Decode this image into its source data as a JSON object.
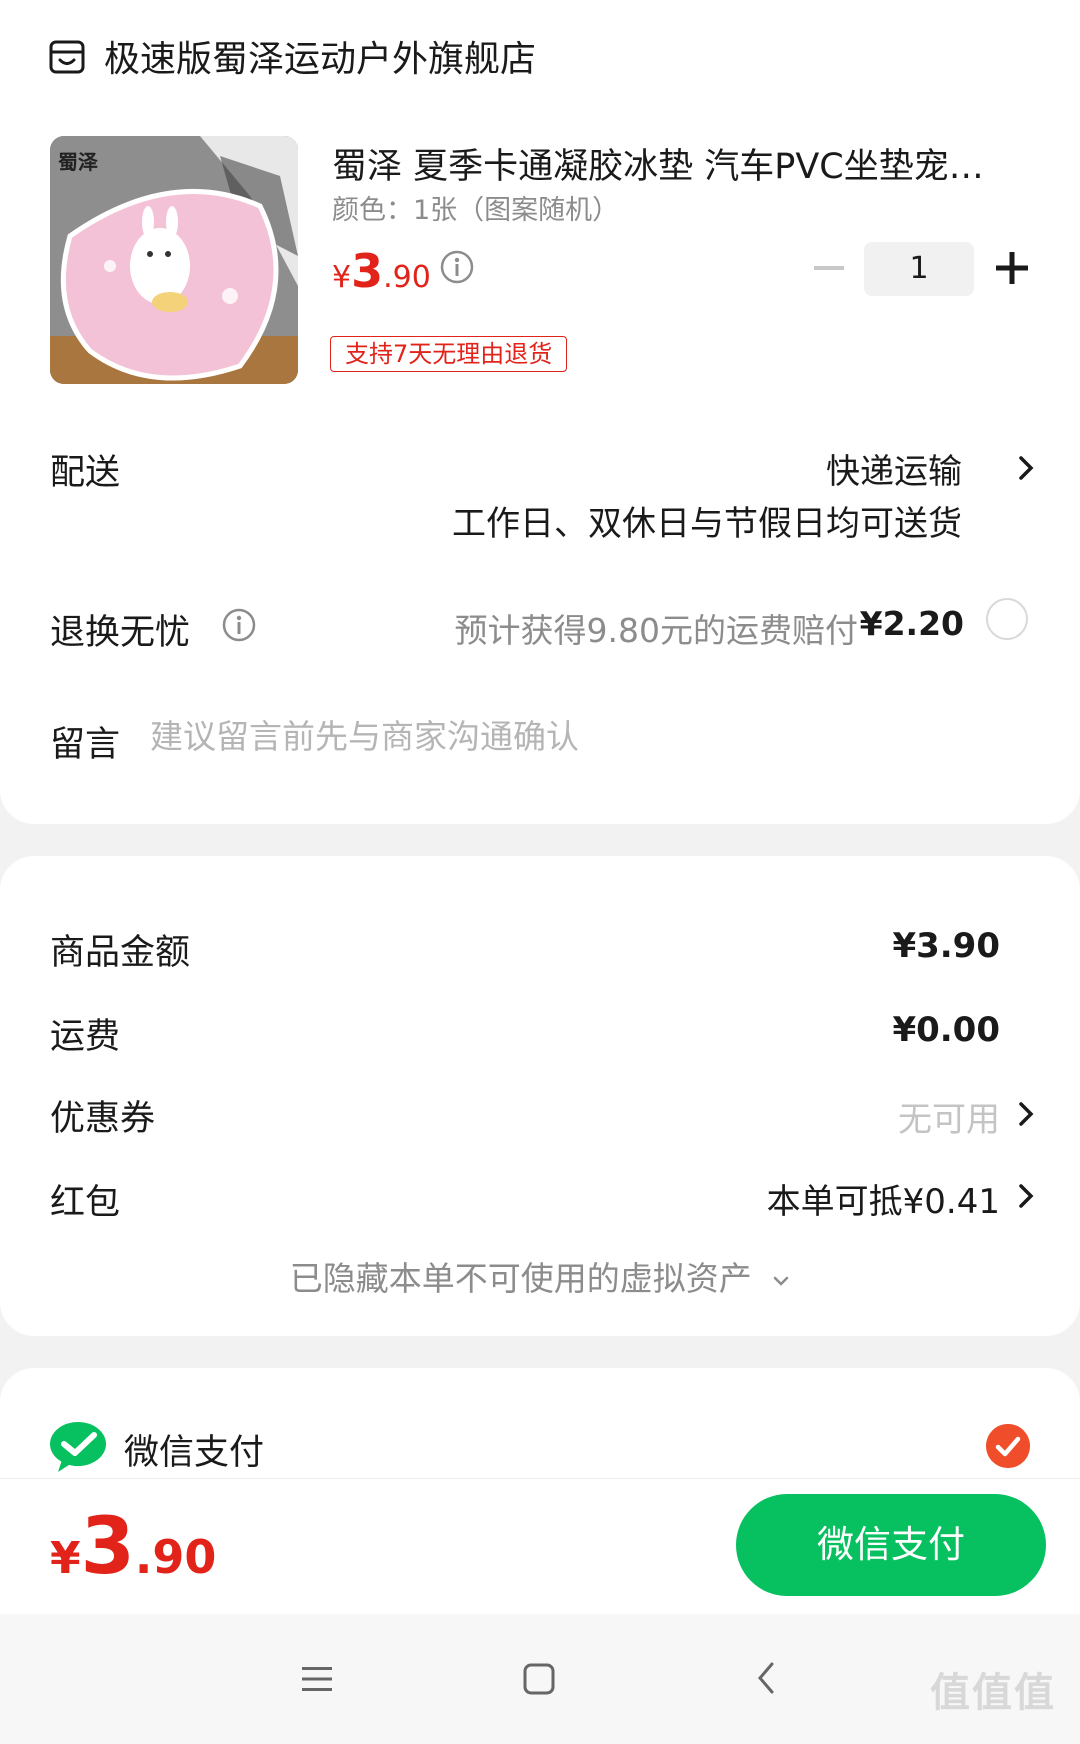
{
  "store": {
    "name": "极速版蜀泽运动户外旗舰店",
    "icon": "store-icon"
  },
  "product": {
    "image_label": "蜀泽",
    "title": "蜀泽 夏季卡通凝胶冰垫 汽车PVC坐垫宠物垫",
    "spec": "颜色：1张（图案随机）",
    "price": {
      "currency": "¥",
      "integer": "3",
      "decimal": ".90"
    },
    "quantity": "1",
    "return_tag": "支持7天无理由退货"
  },
  "delivery": {
    "label": "配送",
    "method": "快递运输",
    "note": "工作日、双休日与节假日均可送货"
  },
  "returns": {
    "label": "退换无忧",
    "desc": "预计获得9.80元的运费赔付",
    "price": "¥2.20",
    "selected": false
  },
  "message": {
    "label": "留言",
    "placeholder": "建议留言前先与商家沟通确认",
    "value": ""
  },
  "summary": {
    "goods_label": "商品金额",
    "goods_value": "¥3.90",
    "shipping_label": "运费",
    "shipping_value": "¥0.00",
    "coupon_label": "优惠券",
    "coupon_value": "无可用",
    "redpack_label": "红包",
    "redpack_value": "本单可抵¥0.41",
    "hidden_assets": "已隐藏本单不可使用的虚拟资产"
  },
  "payment": {
    "method_label": "微信支付",
    "selected": true
  },
  "footer": {
    "total": {
      "currency": "¥",
      "integer": "3",
      "decimal": ".90"
    },
    "pay_button": "微信支付"
  },
  "watermark": "值值值",
  "colors": {
    "price_red": "#e2231a",
    "wechat_green": "#07c160",
    "check_orange": "#f04e2a"
  }
}
